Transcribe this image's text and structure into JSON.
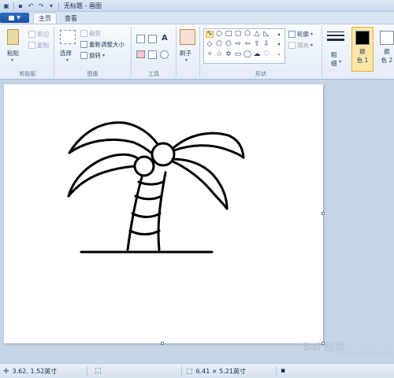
{
  "window": {
    "title": "无标题 - 画图"
  },
  "tabs": [
    {
      "label": "主页",
      "active": true
    },
    {
      "label": "查看",
      "active": false
    }
  ],
  "ribbon": {
    "clipboard": {
      "paste": "粘贴",
      "cut": "剪切",
      "copy": "复制",
      "label": "剪贴板"
    },
    "image": {
      "select": "选择",
      "crop": "裁剪",
      "resize": "重新调整大小",
      "rotate": "旋转",
      "label": "图像"
    },
    "tools": {
      "label": "工具",
      "text_tool": "A"
    },
    "brushes": {
      "label": "刷子"
    },
    "shapes": {
      "outline": "轮廓",
      "fill": "填充",
      "label": "形状"
    },
    "size": {
      "label_line1": "粗",
      "label_line2": "细"
    },
    "color1": {
      "line1": "颜",
      "line2": "色 1",
      "value": "#000000"
    },
    "color2": {
      "line1": "颜",
      "line2": "色 2",
      "value": "#ffffff"
    }
  },
  "status": {
    "cursor_pos": "3.62, 1.52英寸",
    "canvas_size": "6.41 × 5.21英寸"
  },
  "colors": {
    "accent": "#1a4f9e",
    "canvas_bg": "#ffffff",
    "workspace": "#c5d4e7"
  },
  "watermark": {
    "text": "Bai 经验",
    "sub": "jingyan.baidu.com"
  }
}
